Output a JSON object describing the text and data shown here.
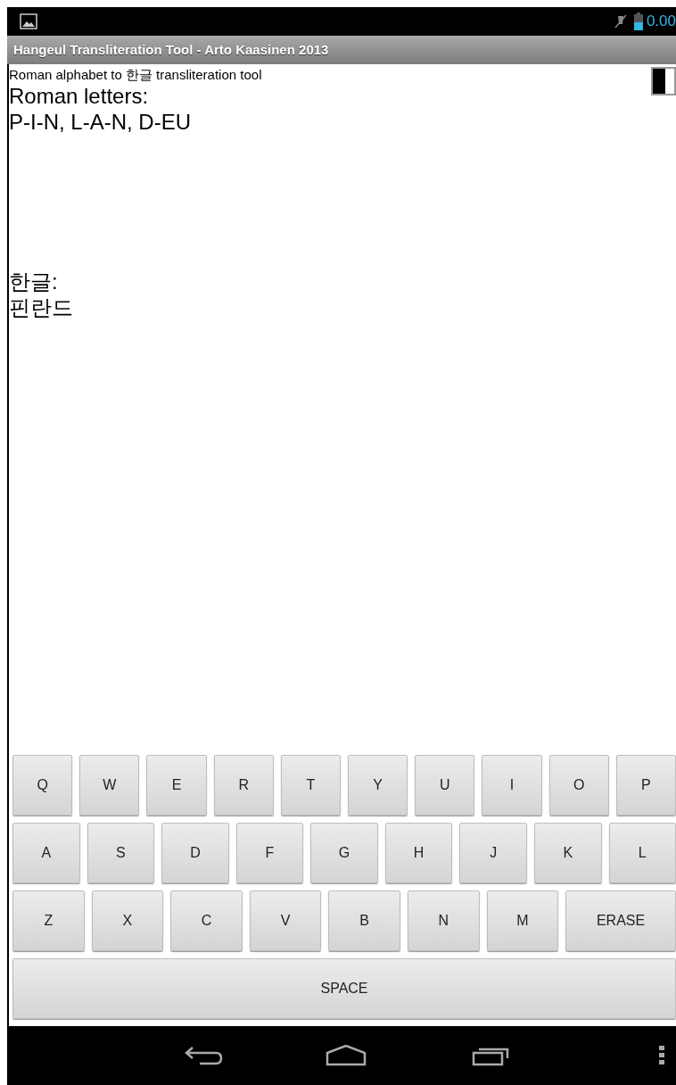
{
  "status_bar": {
    "battery_text": "0.00"
  },
  "title_bar": {
    "title": "Hangeul Transliteration Tool - Arto Kaasinen 2013"
  },
  "content": {
    "subtitle": "Roman alphabet to 한글 transliteration tool",
    "roman_label": "Roman letters:",
    "roman_value": "P-I-N, L-A-N, D-EU",
    "hangul_label": "한글:",
    "hangul_value": "핀란드",
    "toggle": {
      "on": true
    }
  },
  "keyboard": {
    "rows": [
      [
        {
          "kind": "letter",
          "label": "Q"
        },
        {
          "kind": "letter",
          "label": "W"
        },
        {
          "kind": "letter",
          "label": "E"
        },
        {
          "kind": "letter",
          "label": "R"
        },
        {
          "kind": "letter",
          "label": "T"
        },
        {
          "kind": "letter",
          "label": "Y"
        },
        {
          "kind": "letter",
          "label": "U"
        },
        {
          "kind": "letter",
          "label": "I"
        },
        {
          "kind": "letter",
          "label": "O"
        },
        {
          "kind": "letter",
          "label": "P"
        }
      ],
      [
        {
          "kind": "letter",
          "label": "A"
        },
        {
          "kind": "letter",
          "label": "S"
        },
        {
          "kind": "letter",
          "label": "D"
        },
        {
          "kind": "letter",
          "label": "F"
        },
        {
          "kind": "letter",
          "label": "G"
        },
        {
          "kind": "letter",
          "label": "H"
        },
        {
          "kind": "letter",
          "label": "J"
        },
        {
          "kind": "letter",
          "label": "K"
        },
        {
          "kind": "letter",
          "label": "L"
        }
      ],
      [
        {
          "kind": "letter",
          "label": "Z"
        },
        {
          "kind": "letter",
          "label": "X"
        },
        {
          "kind": "letter",
          "label": "C"
        },
        {
          "kind": "letter",
          "label": "V"
        },
        {
          "kind": "letter",
          "label": "B"
        },
        {
          "kind": "letter",
          "label": "N"
        },
        {
          "kind": "letter",
          "label": "M"
        },
        {
          "kind": "erase",
          "label": "ERASE"
        }
      ]
    ],
    "space_bar": {
      "label": "SPACE"
    }
  }
}
